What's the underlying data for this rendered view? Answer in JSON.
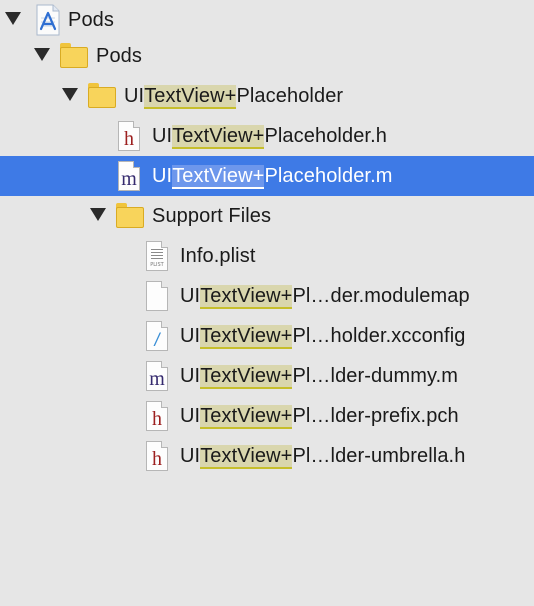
{
  "navigator": {
    "items": [
      {
        "parts": [
          {
            "t": "Pods",
            "hl": false
          }
        ]
      },
      {
        "parts": [
          {
            "t": "Pods",
            "hl": false
          }
        ]
      },
      {
        "parts": [
          {
            "t": "UI",
            "hl": false
          },
          {
            "t": "TextView+",
            "hl": true
          },
          {
            "t": "Placeholder",
            "hl": false
          }
        ]
      },
      {
        "parts": [
          {
            "t": "UI",
            "hl": false
          },
          {
            "t": "TextView+",
            "hl": true
          },
          {
            "t": "Placeholder.h",
            "hl": false
          }
        ]
      },
      {
        "parts": [
          {
            "t": "UI",
            "hl": false
          },
          {
            "t": "TextView+",
            "hl": true
          },
          {
            "t": "Placeholder.m",
            "hl": false
          }
        ]
      },
      {
        "parts": [
          {
            "t": "Support Files",
            "hl": false
          }
        ]
      },
      {
        "parts": [
          {
            "t": "Info.plist",
            "hl": false
          }
        ]
      },
      {
        "parts": [
          {
            "t": "UI",
            "hl": false
          },
          {
            "t": "TextView+",
            "hl": true
          },
          {
            "t": "Pl…der.modulemap",
            "hl": false
          }
        ]
      },
      {
        "parts": [
          {
            "t": "UI",
            "hl": false
          },
          {
            "t": "TextView+",
            "hl": true
          },
          {
            "t": "Pl…holder.xcconfig",
            "hl": false
          }
        ]
      },
      {
        "parts": [
          {
            "t": "UI",
            "hl": false
          },
          {
            "t": "TextView+",
            "hl": true
          },
          {
            "t": "Pl…lder-dummy.m",
            "hl": false
          }
        ]
      },
      {
        "parts": [
          {
            "t": "UI",
            "hl": false
          },
          {
            "t": "TextView+",
            "hl": true
          },
          {
            "t": "Pl…lder-prefix.pch",
            "hl": false
          }
        ]
      },
      {
        "parts": [
          {
            "t": "UI",
            "hl": false
          },
          {
            "t": "TextView+",
            "hl": true
          },
          {
            "t": "Pl…lder-umbrella.h",
            "hl": false
          }
        ]
      }
    ],
    "icon_glyphs": {
      "h": "h",
      "m": "m",
      "xcconfig": "/",
      "plist": "PLIST"
    },
    "colors": {
      "selection": "#3e7ae6",
      "match_highlight": "#d9d6ad",
      "folder": "#f8d45b"
    }
  }
}
